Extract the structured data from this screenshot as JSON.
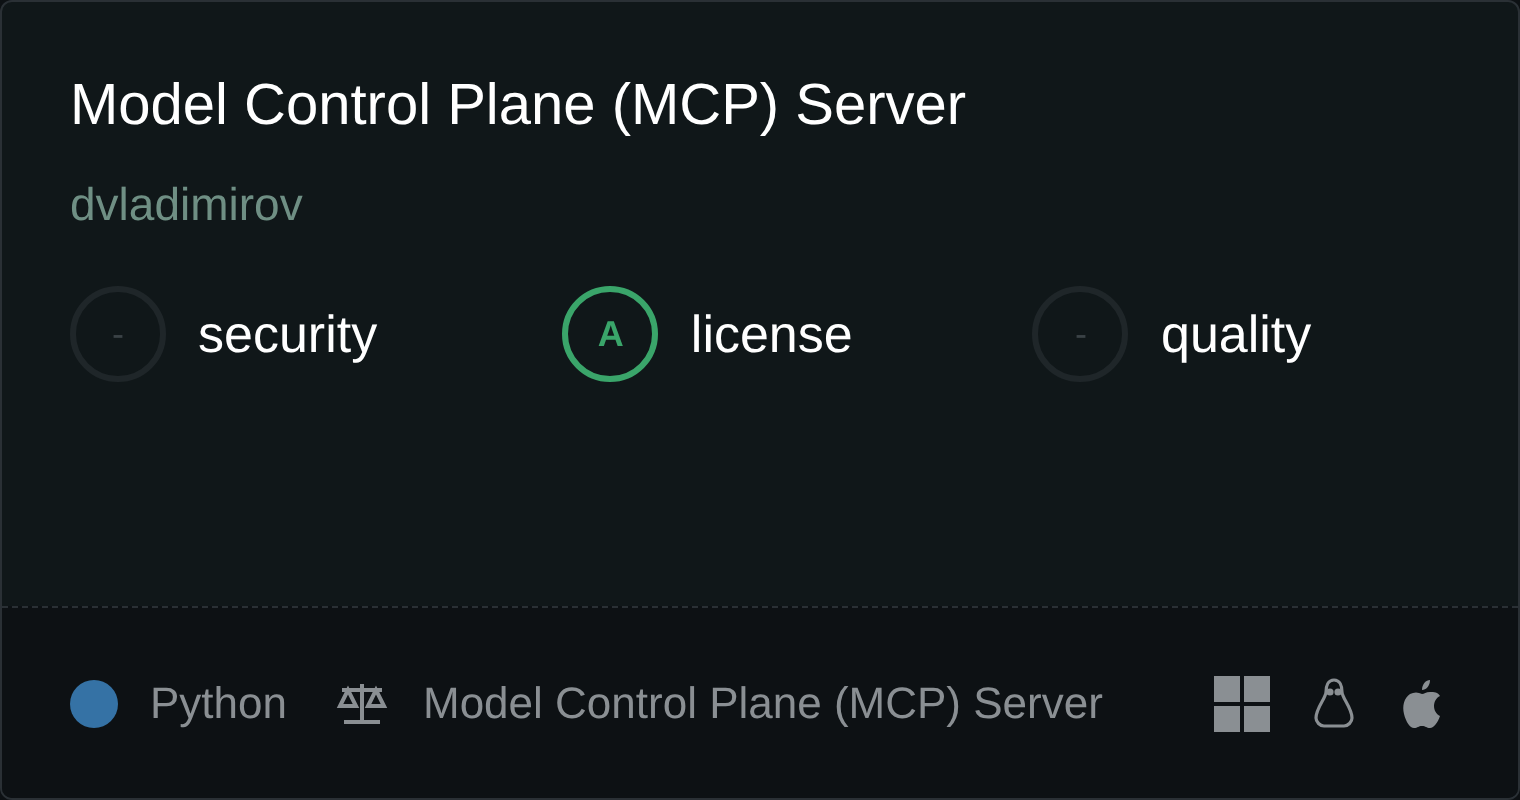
{
  "title": "Model Control Plane (MCP) Server",
  "author": "dvladimirov",
  "scores": [
    {
      "grade": "-",
      "label": "security",
      "rated": false
    },
    {
      "grade": "A",
      "label": "license",
      "rated": true
    },
    {
      "grade": "-",
      "label": "quality",
      "rated": false
    }
  ],
  "footer": {
    "language": {
      "name": "Python",
      "color": "#3572a5"
    },
    "license": "Model Control Plane (MCP) Server",
    "platforms": [
      {
        "kind": "windows"
      },
      {
        "kind": "linux"
      },
      {
        "kind": "apple"
      }
    ]
  }
}
